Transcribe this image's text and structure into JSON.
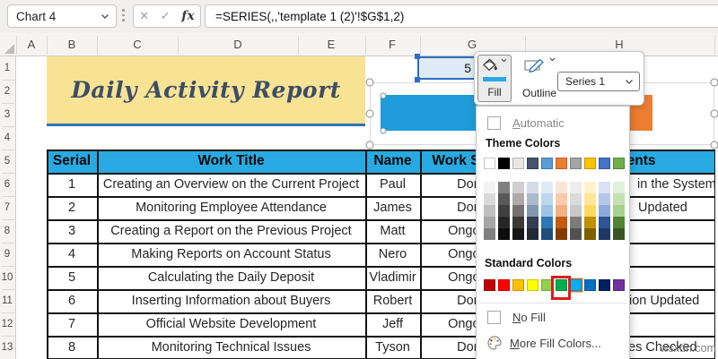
{
  "window": {
    "name_box": "Chart 4",
    "formula": "=SERIES(,,'template 1 (2)'!$G$1,2)",
    "fx": "fx",
    "cancel_icon": "✕",
    "enter_icon": "✓"
  },
  "grid": {
    "columns": [
      "A",
      "B",
      "C",
      "D",
      "E",
      "F",
      "G",
      "H"
    ],
    "rows": [
      "1",
      "2",
      "3",
      "4",
      "5",
      "6",
      "7",
      "8",
      "9",
      "10",
      "11",
      "12",
      "13"
    ],
    "g1_visible_value": "5"
  },
  "title_banner": {
    "text": "Daily Activity Report",
    "bg": "#f8e294",
    "text_color": "#3c4e66",
    "underline_color": "#2e75b6"
  },
  "chart": {
    "bar1_color": "#1f9cd9",
    "bar2_color": "#ed7d31"
  },
  "table": {
    "header_bg": "#29a9e1",
    "headers": {
      "serial": "Serial",
      "work_title": "Work Title",
      "name": "Name",
      "work_status": "Work Status",
      "comments": "Comments"
    },
    "rows": [
      {
        "serial": "1",
        "title": "Creating an Overview on the Current Project",
        "name": "Paul",
        "status": "Done",
        "comment_fragment": "in the System"
      },
      {
        "serial": "2",
        "title": "Monitoring Employee Attendance",
        "name": "James",
        "status": "Done",
        "comment_fragment": "Updated"
      },
      {
        "serial": "3",
        "title": "Creating a Report on the Previous Project",
        "name": "Matt",
        "status": "Ongoing",
        "comment_fragment": ""
      },
      {
        "serial": "4",
        "title": "Making Reports on Account Status",
        "name": "Nero",
        "status": "Ongoing",
        "comment_fragment": ""
      },
      {
        "serial": "5",
        "title": "Calculating the Daily Deposit",
        "name": "Vladimir",
        "status": "Ongoing",
        "comment_fragment": ""
      },
      {
        "serial": "6",
        "title": "Inserting Information about Buyers",
        "name": "Robert",
        "status": "Done",
        "comment_fragment": "ion Updated"
      },
      {
        "serial": "7",
        "title": "Official Website Development",
        "name": "Jeff",
        "status": "Ongoing",
        "comment_fragment": ""
      },
      {
        "serial": "8",
        "title": "Monitoring Technical Issues",
        "name": "Tyson",
        "status": "Done",
        "comment_fragment": "es Checked"
      }
    ]
  },
  "popup": {
    "fill_label": "Fill",
    "outline_label": "Outline",
    "series_selector_value": "Series 1",
    "fill_current_color": "#29a9e1",
    "menu": {
      "automatic": "Automatic",
      "theme_heading": "Theme Colors",
      "standard_heading": "Standard Colors",
      "no_fill": "No Fill",
      "more_fill_colors": "More Fill Colors...",
      "theme_colors": [
        "#ffffff",
        "#000000",
        "#e7e6e6",
        "#44546a",
        "#5b9bd5",
        "#ed7d31",
        "#a5a5a5",
        "#ffc000",
        "#4472c4",
        "#70ad47"
      ],
      "theme_variants": [
        [
          "#f2f2f2",
          "#808080",
          "#d0cece",
          "#d6dce5",
          "#deebf7",
          "#fbe5d6",
          "#ededed",
          "#fff2cc",
          "#d9e2f3",
          "#e2efda"
        ],
        [
          "#d9d9d9",
          "#595959",
          "#aeaaaa",
          "#acb9ca",
          "#bdd7ee",
          "#f8cbad",
          "#dbdbdb",
          "#ffe699",
          "#b4c7e7",
          "#c6e0b4"
        ],
        [
          "#bfbfbf",
          "#404040",
          "#757171",
          "#8497b0",
          "#9dc3e6",
          "#f4b183",
          "#c9c9c9",
          "#ffd966",
          "#8eaadb",
          "#a9d08e"
        ],
        [
          "#a6a6a6",
          "#262626",
          "#3b3838",
          "#333f50",
          "#2e75b6",
          "#c55a11",
          "#7b7b7b",
          "#bf9000",
          "#2f5496",
          "#548235"
        ],
        [
          "#808080",
          "#0d0d0d",
          "#181717",
          "#222b35",
          "#1f4e79",
          "#833c00",
          "#525252",
          "#7f6000",
          "#1f3864",
          "#375623"
        ]
      ],
      "standard_colors": [
        "#c00000",
        "#ff0000",
        "#ffc000",
        "#ffff00",
        "#92d050",
        "#00b050",
        "#00b0f0",
        "#0070c0",
        "#002060",
        "#7030a0"
      ],
      "annotated_color": "#00b050",
      "current_selected_color": "#00b0f0"
    }
  },
  "watermark": "wsxdn.com"
}
